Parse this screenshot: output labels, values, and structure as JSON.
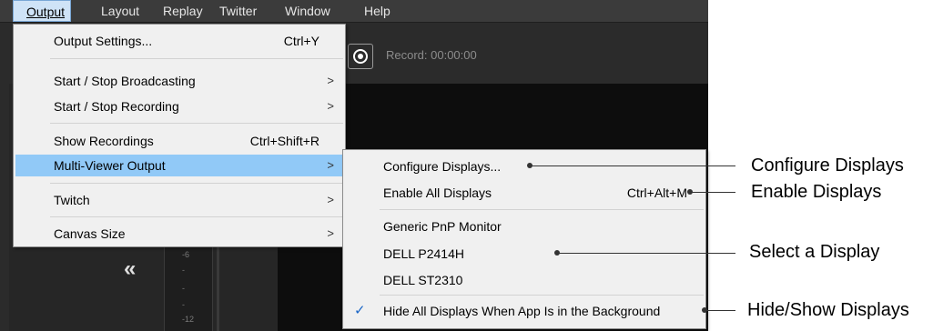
{
  "menubar": {
    "items": [
      "Output",
      "Layout",
      "Replay",
      "Twitter",
      "Window",
      "Help"
    ]
  },
  "toolbar": {
    "record_label": "Record: 00:00:00"
  },
  "meter": {
    "ticks": [
      "-6",
      "-",
      "-",
      "-",
      "-12"
    ]
  },
  "collapse_glyph": "«",
  "output_menu": {
    "items": [
      {
        "label": "Output Settings...",
        "shortcut": "Ctrl+Y",
        "submenu": false
      },
      {
        "label": "Start / Stop Broadcasting",
        "shortcut": "",
        "submenu": true
      },
      {
        "label": "Start / Stop Recording",
        "shortcut": "",
        "submenu": true
      },
      {
        "label": "Show Recordings",
        "shortcut": "Ctrl+Shift+R",
        "submenu": false
      },
      {
        "label": "Multi-Viewer Output",
        "shortcut": "",
        "submenu": true,
        "highlighted": true
      },
      {
        "label": "Twitch",
        "shortcut": "",
        "submenu": true
      },
      {
        "label": "Canvas Size",
        "shortcut": "",
        "submenu": true
      }
    ],
    "arrow": ">"
  },
  "multiviewer_menu": {
    "items": [
      {
        "label": "Configure Displays...",
        "shortcut": ""
      },
      {
        "label": "Enable All Displays",
        "shortcut": "Ctrl+Alt+M"
      },
      {
        "label": "Generic PnP Monitor",
        "shortcut": ""
      },
      {
        "label": "DELL P2414H",
        "shortcut": ""
      },
      {
        "label": "DELL ST2310",
        "shortcut": ""
      },
      {
        "label": "Hide All Displays When App Is in the Background",
        "shortcut": "",
        "checked": true
      }
    ],
    "check_glyph": "✓"
  },
  "callouts": [
    "Configure Displays",
    "Enable Displays",
    "Select a Display",
    "Hide/Show Displays"
  ]
}
